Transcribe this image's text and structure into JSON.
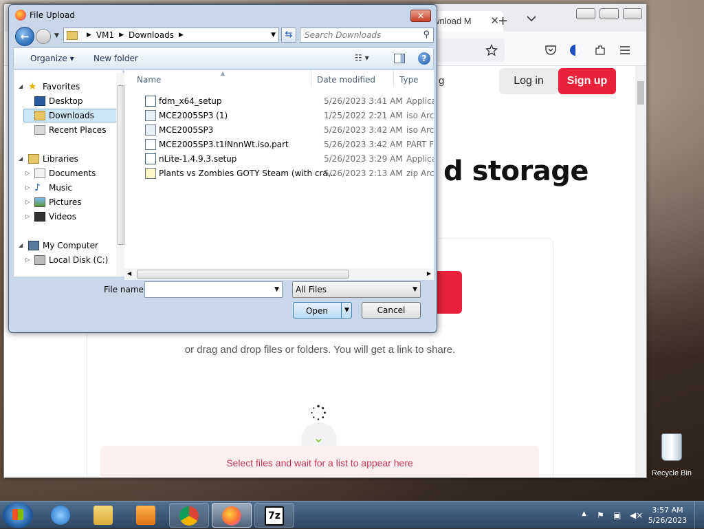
{
  "browser": {
    "tab_title": "wnload M",
    "tab_close": "✕",
    "new_tab": "+",
    "page": {
      "login_label": "Log in",
      "signup_label": "Sign up",
      "heading_partial": "d storage",
      "drag_text": "or drag and drop files or folders. You will get a link to share.",
      "select_msg": "Select files and wait for a list to appear here",
      "partial_text": "g"
    }
  },
  "dialog": {
    "title": "File Upload",
    "close_label": "✕",
    "breadcrumb": [
      "VM1",
      "Downloads"
    ],
    "search_placeholder": "Search Downloads",
    "toolbar": {
      "organize_label": "Organize ▾",
      "new_folder_label": "New folder",
      "help_label": "?"
    },
    "nav_tree": {
      "favorites": "Favorites",
      "desktop": "Desktop",
      "downloads": "Downloads",
      "recent_places": "Recent Places",
      "libraries": "Libraries",
      "documents": "Documents",
      "music": "Music",
      "pictures": "Pictures",
      "videos": "Videos",
      "my_computer": "My Computer",
      "local_disk": "Local Disk (C:)"
    },
    "columns": {
      "name": "Name",
      "date_modified": "Date modified",
      "type": "Type"
    },
    "files": [
      {
        "name": "fdm_x64_setup",
        "date": "5/26/2023 3:41 AM",
        "type": "Applicatio",
        "icon": "installer-icon"
      },
      {
        "name": "MCE2005SP3 (1)",
        "date": "1/25/2022 2:21 AM",
        "type": "iso Archiv",
        "icon": "iso-icon"
      },
      {
        "name": "MCE2005SP3",
        "date": "5/26/2023 3:42 AM",
        "type": "iso Archiv",
        "icon": "iso-icon"
      },
      {
        "name": "MCE2005SP3.t1INnnWt.iso.part",
        "date": "5/26/2023 3:42 AM",
        "type": "PART File",
        "icon": "blank-file-icon"
      },
      {
        "name": "nLite-1.4.9.3.setup",
        "date": "5/26/2023 3:29 AM",
        "type": "Applicatio",
        "icon": "installer-icon"
      },
      {
        "name": "Plants vs Zombies GOTY Steam (with cra...",
        "date": "5/26/2023 2:13 AM",
        "type": "zip Archiv",
        "icon": "zip-icon"
      }
    ],
    "file_name_label": "File name:",
    "file_name_value": "",
    "filter_value": "All Files",
    "open_label": "Open",
    "cancel_label": "Cancel"
  },
  "taskbar": {
    "apps": [
      "start",
      "internet-explorer",
      "windows-explorer",
      "media-player",
      "chrome",
      "firefox",
      "7-zip"
    ],
    "clock_time": "3:57 AM",
    "clock_date": "5/26/2023"
  },
  "desktop": {
    "recycle_bin_label": "Recycle Bin"
  }
}
